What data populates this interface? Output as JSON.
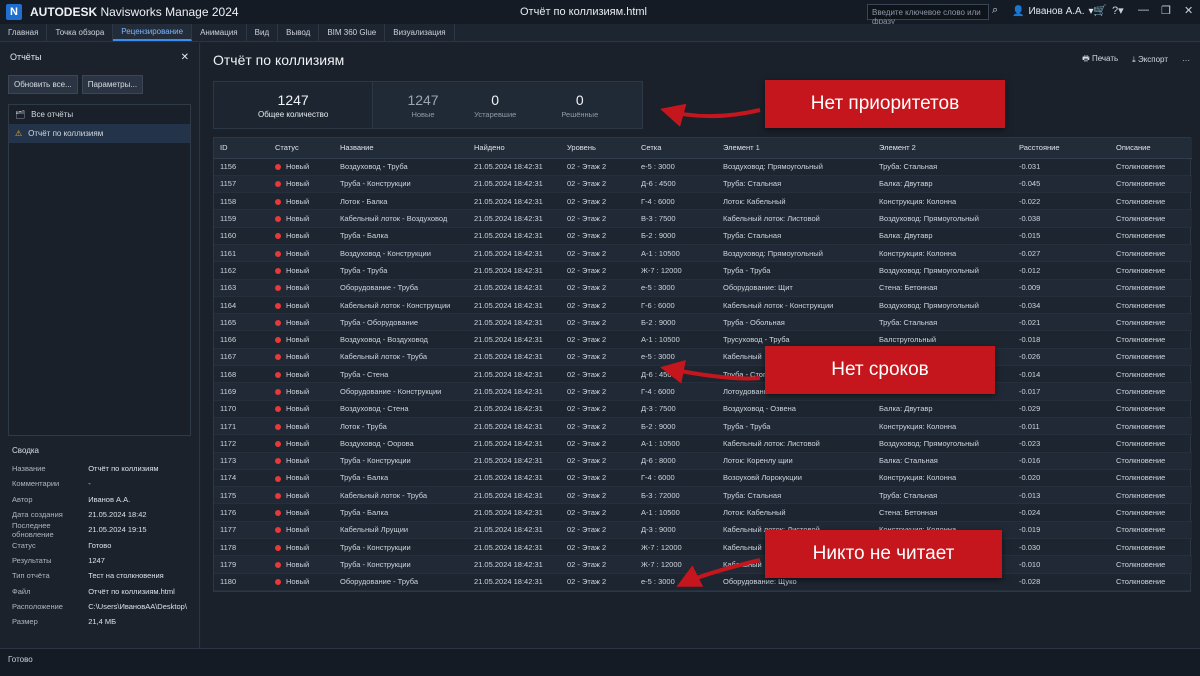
{
  "titlebar": {
    "brand": "AUTODESK",
    "product": "Navisworks Manage 2024",
    "doc_title": "Отчёт по коллизиям.html",
    "search_placeholder": "Введите ключевое слово или фразу",
    "user": "Иванов А.А.",
    "icons": [
      "search-icon",
      "user-icon",
      "cart-icon",
      "help-icon",
      "minimize-icon",
      "restore-icon",
      "close-icon"
    ]
  },
  "menu": [
    "Главная",
    "Точка обзора",
    "Рецензирование",
    "Анимация",
    "Вид",
    "Вывод",
    "BIM 360 Glue",
    "Визуализация"
  ],
  "menu_active": "Рецензирование",
  "left_panel": {
    "title": "Отчёты",
    "refresh_button": "Обновить все...",
    "params_button": "Параметры...",
    "tree": [
      {
        "label": "Все отчёты",
        "icon": "reports-icon"
      },
      {
        "label": "Отчёт по коллизиям",
        "icon": "warning-icon"
      }
    ],
    "summary_title": "Сводка",
    "summary": [
      {
        "k": "Название",
        "v": "Отчёт по коллизиям"
      },
      {
        "k": "Комментарии",
        "v": "-"
      },
      {
        "k": "Автор",
        "v": "Иванов А.А."
      },
      {
        "k": "Дата создания",
        "v": "21.05.2024 18:42"
      },
      {
        "k": "Последнее обновление",
        "v": "21.05.2024 19:15"
      },
      {
        "k": "Статус",
        "v": "Готово"
      },
      {
        "k": "Результаты",
        "v": "1247"
      },
      {
        "k": "Тип отчёта",
        "v": "Тест на столкновения"
      },
      {
        "k": "Файл",
        "v": "Отчёт по коллизиям.html"
      },
      {
        "k": "Расположение",
        "v": "C:\\Users\\ИвановАА\\Desktop\\..."
      },
      {
        "k": "Размер",
        "v": "21,4 МБ"
      }
    ]
  },
  "main": {
    "title": "Отчёт по коллизиям",
    "print_label": "Печать",
    "export_label": "Экспорт",
    "stats": {
      "total_value": "1247",
      "total_label": "Общее количество",
      "new_value": "1247",
      "new_label": "Новые",
      "old_value": "0",
      "old_label": "Устаревшие",
      "resolved_value": "0",
      "resolved_label": "Решённые"
    },
    "columns": [
      "ID",
      "Статус",
      "Название",
      "Найдено",
      "Уровень",
      "Сетка",
      "Элемент 1",
      "Элемент 2",
      "Расстояние",
      "Описание"
    ],
    "rows": [
      [
        "1156",
        "Новый",
        "Воздуховод - Труба",
        "21.05.2024 18:42:31",
        "02 - Этаж 2",
        "е-5 : 3000",
        "Воздуховод: Прямоугольный",
        "Труба: Стальная",
        "-0.031",
        "Столкновение"
      ],
      [
        "1157",
        "Новый",
        "Труба - Конструкции",
        "21.05.2024 18:42:31",
        "02 - Этаж 2",
        "Д-6 : 4500",
        "Труба: Стальная",
        "Балка: Двутавр",
        "-0.045",
        "Столкновение"
      ],
      [
        "1158",
        "Новый",
        "Лоток - Балка",
        "21.05.2024 18:42:31",
        "02 - Этаж 2",
        "Г-4 : 6000",
        "Лоток: Кабельный",
        "Конструкция: Колонна",
        "-0.022",
        "Столкновение"
      ],
      [
        "1159",
        "Новый",
        "Кабельный лоток - Воздуховод",
        "21.05.2024 18:42:31",
        "02 - Этаж 2",
        "В-3 : 7500",
        "Кабельный лоток: Листовой",
        "Воздуховод: Прямоугольный",
        "-0.038",
        "Столкновение"
      ],
      [
        "1160",
        "Новый",
        "Труба - Балка",
        "21.05.2024 18:42:31",
        "02 - Этаж 2",
        "Б-2 : 9000",
        "Труба: Стальная",
        "Балка: Двутавр",
        "-0.015",
        "Столкновение"
      ],
      [
        "1161",
        "Новый",
        "Воздуховод - Конструкции",
        "21.05.2024 18:42:31",
        "02 - Этаж 2",
        "А-1 : 10500",
        "Воздуховод: Прямоугольный",
        "Конструкция: Колонна",
        "-0.027",
        "Столкновение"
      ],
      [
        "1162",
        "Новый",
        "Труба - Труба",
        "21.05.2024 18:42:31",
        "02 - Этаж 2",
        "Ж-7 : 12000",
        "Труба - Труба",
        "Воздуховод: Прямоугольный",
        "-0.012",
        "Столкновение"
      ],
      [
        "1163",
        "Новый",
        "Оборудование - Труба",
        "21.05.2024 18:42:31",
        "02 - Этаж 2",
        "е-5 : 3000",
        "Оборудование: Щит",
        "Стена: Бетонная",
        "-0.009",
        "Столкновение"
      ],
      [
        "1164",
        "Новый",
        "Кабельный лоток - Конструкции",
        "21.05.2024 18:42:31",
        "02 - Этаж 2",
        "Г-6 : 6000",
        "Кабельный лоток - Конструкции",
        "Воздуховод: Прямоугольный",
        "-0.034",
        "Столкновение"
      ],
      [
        "1165",
        "Новый",
        "Труба - Оборудование",
        "21.05.2024 18:42:31",
        "02 - Этаж 2",
        "Б-2 : 9000",
        "Труба - Обольная",
        "Труба: Стальная",
        "-0.021",
        "Столкновение"
      ],
      [
        "1166",
        "Новый",
        "Воздуховод - Воздуховод",
        "21.05.2024 18:42:31",
        "02 - Этаж 2",
        "А-1 : 10500",
        "Трусуховод - Труба",
        "Балстругольный",
        "-0.018",
        "Столкновение"
      ],
      [
        "1167",
        "Новый",
        "Кабельный лоток - Труба",
        "21.05.2024 18:42:31",
        "02 - Этаж 2",
        "е-5 : 3000",
        "Кабельный",
        "",
        "-0.026",
        "Столкновение"
      ],
      [
        "1168",
        "Новый",
        "Труба - Стена",
        "21.05.2024 18:42:31",
        "02 - Этаж 2",
        "Д-6 : 4500",
        "Труба - Стоп",
        "",
        "-0.014",
        "Столкновение"
      ],
      [
        "1169",
        "Новый",
        "Оборудование - Конструкции",
        "21.05.2024 18:42:31",
        "02 - Этаж 2",
        "Г-4 : 6000",
        "Лотоудованн",
        "",
        "-0.017",
        "Столкновение"
      ],
      [
        "1170",
        "Новый",
        "Воздуховод - Стена",
        "21.05.2024 18:42:31",
        "02 - Этаж 2",
        "Д-3 : 7500",
        "Воздуховод - Озвена",
        "Балка: Двутавр",
        "-0.029",
        "Столкновение"
      ],
      [
        "1171",
        "Новый",
        "Лоток - Труба",
        "21.05.2024 18:42:31",
        "02 - Этаж 2",
        "Б-2 : 9000",
        "Труба - Труба",
        "Конструкция: Колонна",
        "-0.011",
        "Столкновение"
      ],
      [
        "1172",
        "Новый",
        "Воздуховод - Оорова",
        "21.05.2024 18:42:31",
        "02 - Этаж 2",
        "А-1 : 10500",
        "Кабельный лоток: Листовой",
        "Воздуховод: Прямоугольный",
        "-0.023",
        "Столкновение"
      ],
      [
        "1173",
        "Новый",
        "Труба - Конструкции",
        "21.05.2024 18:42:31",
        "02 - Этаж 2",
        "Д-6 : 8000",
        "Лоток: Коренлу щии",
        "Балка: Стальная",
        "-0.016",
        "Столкновение"
      ],
      [
        "1174",
        "Новый",
        "Труба - Балка",
        "21.05.2024 18:42:31",
        "02 - Этаж 2",
        "Г-4 : 6000",
        "Возоуховй Лорокукции",
        "Конструкция: Колонна",
        "-0.020",
        "Столкновение"
      ],
      [
        "1175",
        "Новый",
        "Кабельный лоток - Труба",
        "21.05.2024 18:42:31",
        "02 - Этаж 2",
        "Б-3 : 72000",
        "Труба: Стальная",
        "Труба: Стальная",
        "-0.013",
        "Столкновение"
      ],
      [
        "1176",
        "Новый",
        "Труба - Балка",
        "21.05.2024 18:42:31",
        "02 - Этаж 2",
        "А-1 : 10500",
        "Лоток: Кабельный",
        "Стена: Бетонная",
        "-0.024",
        "Столкновение"
      ],
      [
        "1177",
        "Новый",
        "Кабельный Лрущии",
        "21.05.2024 18:42:31",
        "02 - Этаж 2",
        "Д-3 : 9000",
        "Кабельный лоток: Листовой",
        "Конструкция: Колонна",
        "-0.019",
        "Столкновение"
      ],
      [
        "1178",
        "Новый",
        "Труба - Конструкции",
        "21.05.2024 18:42:31",
        "02 - Этаж 2",
        "Ж-7 : 12000",
        "Кабельный",
        "",
        "-0.030",
        "Столкновение"
      ],
      [
        "1179",
        "Новый",
        "Труба - Конструкции",
        "21.05.2024 18:42:31",
        "02 - Этаж 2",
        "Ж-7 : 12000",
        "Кабельный",
        "",
        "-0.010",
        "Столкновение"
      ],
      [
        "1180",
        "Новый",
        "Оборудование - Труба",
        "21.05.2024 18:42:31",
        "02 - Этаж 2",
        "е-5 : 3000",
        "Оборудование: Щуко",
        "",
        "-0.028",
        "Столкновение"
      ]
    ]
  },
  "callouts": {
    "no_priorities": "Нет приоритетов",
    "no_deadlines": "Нет сроков",
    "nobody_reads": "Никто не читает"
  },
  "status_color": "#e5393a",
  "callout_color": "#c4161c",
  "statusbar": "Готово"
}
